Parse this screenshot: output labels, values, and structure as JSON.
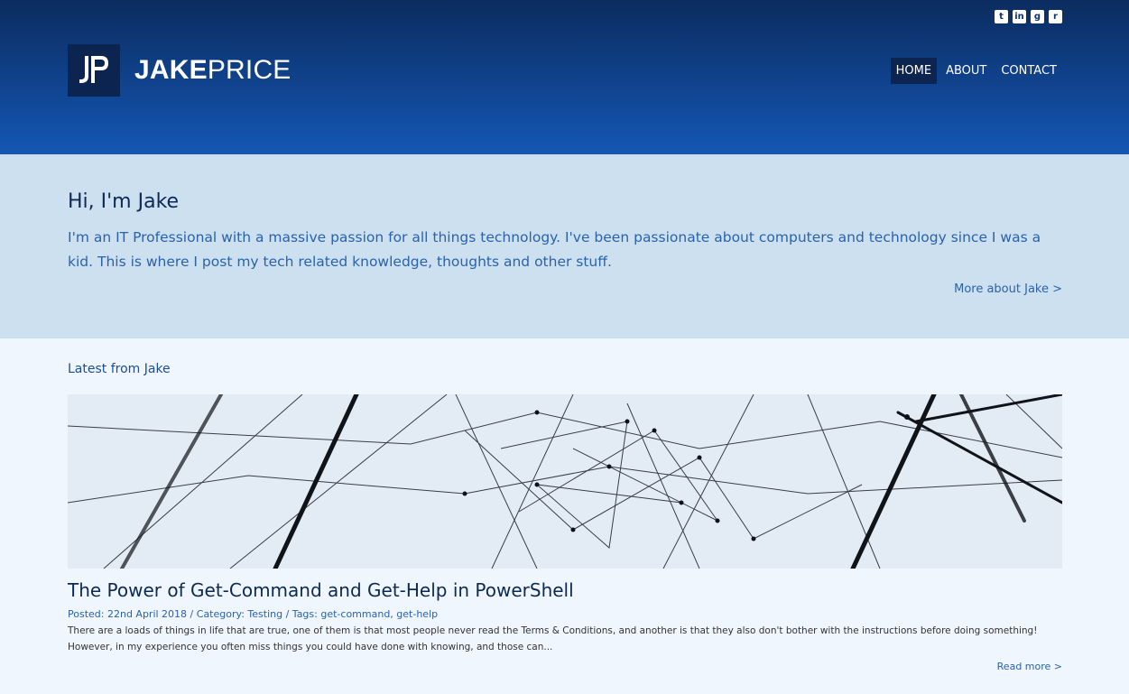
{
  "header": {
    "brand_first": "JAKE",
    "brand_second": "PRICE",
    "nav": [
      {
        "label": "HOME"
      },
      {
        "label": "ABOUT"
      },
      {
        "label": "CONTACT"
      }
    ],
    "social": [
      {
        "icon": "twitter-icon",
        "glyph": "t"
      },
      {
        "icon": "linkedin-icon",
        "glyph": "in"
      },
      {
        "icon": "github-icon",
        "glyph": "g"
      },
      {
        "icon": "rss-icon",
        "glyph": "r"
      }
    ]
  },
  "intro": {
    "heading": "Hi, I'm Jake",
    "text": "I'm an IT Professional with a massive passion for all things technology. I've been passionate about computers and technology since I was a kid. This is where I post my tech related knowledge, thoughts and other stuff.",
    "more_link": "More about Jake >"
  },
  "latest": {
    "heading": "Latest from Jake",
    "post": {
      "title": "The Power of Get-Command and Get-Help in PowerShell",
      "posted_label": "Posted: ",
      "date": "22nd April 2018",
      "category_label": " / Category: ",
      "category": "Testing",
      "tags_label": " / Tags: ",
      "tag1": "get-command",
      "tag_sep": ", ",
      "tag2": "get-help",
      "excerpt": "There are a loads of things in life that are true, one of them is that most people never read the Terms & Conditions, and another is that they also don't bother with the instructions before doing something! However, in my experience you often miss things you could have done with knowing, and those can...",
      "read_more": "Read more >"
    }
  },
  "colors": {
    "header_top": "#0b2c5e",
    "header_bottom": "#1457b5",
    "intro_bg": "#cde0f0",
    "accent": "#2a62ad",
    "dark": "#0b2550"
  }
}
